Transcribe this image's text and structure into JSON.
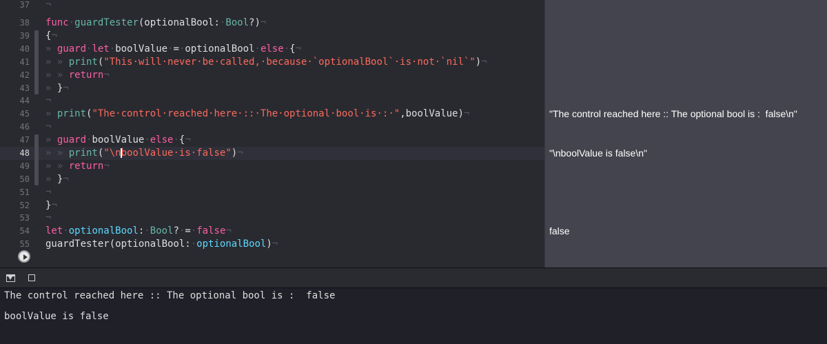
{
  "editor": {
    "line_numbers": [
      "37",
      "38",
      "39",
      "40",
      "41",
      "42",
      "43",
      "44",
      "45",
      "46",
      "47",
      "48",
      "49",
      "50",
      "51",
      "52",
      "53",
      "54",
      "55"
    ],
    "current_line": "48",
    "lines": {
      "l37": {
        "p1": "¬"
      },
      "l38": {
        "p1": "func",
        "p2": "·",
        "p3": "guardTester",
        "p4": "(optionalBool:",
        "p5": "·",
        "p6": "Bool",
        "p7": "?)",
        "p8": "¬"
      },
      "l39": {
        "p1": "{",
        "p2": "¬"
      },
      "l40": {
        "p1": "» ",
        "p2": "guard",
        "p3": "·",
        "p4": "let",
        "p5": "·",
        "p6": "boolValue",
        "p7": "·",
        "p8": "=",
        "p9": "·",
        "p10": "optionalBool",
        "p11": "·",
        "p12": "else",
        "p13": "·",
        "p14": "{",
        "p15": "¬"
      },
      "l41": {
        "p1": "» » ",
        "p2": "print",
        "p3": "(",
        "p4": "\"This·will·never·be·called,·because·`optionalBool`·is·not·`nil`\"",
        "p5": ")",
        "p6": "¬"
      },
      "l42": {
        "p1": "» » ",
        "p2": "return",
        "p3": "¬"
      },
      "l43": {
        "p1": "» ",
        "p2": "}",
        "p3": "¬"
      },
      "l44": {
        "p1": "¬"
      },
      "l45": {
        "p1": "» ",
        "p2": "print",
        "p3": "(",
        "p4": "\"The·control·reached·here·::·The·optional·bool·is·:·\"",
        "p5": ",boolValue)",
        "p6": "¬"
      },
      "l46": {
        "p1": "¬"
      },
      "l47": {
        "p1": "» ",
        "p2": "guard",
        "p3": "·",
        "p4": "boolValue",
        "p5": "·",
        "p6": "else",
        "p7": "·",
        "p8": "{",
        "p9": "¬"
      },
      "l48": {
        "p1": "» » ",
        "p2": "print",
        "p3": "(",
        "p4a": "\"\\n",
        "p4b": "boolValue·is·false\"",
        "p5": ")",
        "p6": "¬"
      },
      "l49": {
        "p1": "» » ",
        "p2": "return",
        "p3": "¬"
      },
      "l50": {
        "p1": "» ",
        "p2": "}",
        "p3": "¬"
      },
      "l51": {
        "p1": "¬"
      },
      "l52": {
        "p1": "}",
        "p2": "¬"
      },
      "l53": {
        "p1": "¬"
      },
      "l54": {
        "p1": "let",
        "p2": "·",
        "p3": "optionalBool",
        "p4": ":",
        "p5": "·",
        "p6": "Bool",
        "p7": "?",
        "p8": "·",
        "p9": "=",
        "p10": "·",
        "p11": "false",
        "p12": "¬"
      },
      "l55": {
        "p1": "guardTester",
        "p2": "(optionalBool:",
        "p3": "·",
        "p4": "optionalBool",
        "p5": ")",
        "p6": "¬"
      }
    }
  },
  "results": {
    "r45": "\"The control reached here :: The optional bool is :  false\\n\"",
    "r48": "\"\\nboolValue is false\\n\"",
    "r54": "false"
  },
  "console": {
    "output_line_1": "The control reached here :: The optional bool is :  false",
    "output_line_2": "boolValue is false"
  },
  "icons": {
    "run": "play-circle-icon",
    "toggle_debug": "hide-debug-area-icon",
    "stop": "stop-square-icon"
  },
  "colors": {
    "keyword": "#fc5fa3",
    "function": "#67b7a4",
    "type": "#5dd8ff",
    "string": "#fc6a5d",
    "editor_bg": "#292a30",
    "results_bg": "#44444e"
  }
}
